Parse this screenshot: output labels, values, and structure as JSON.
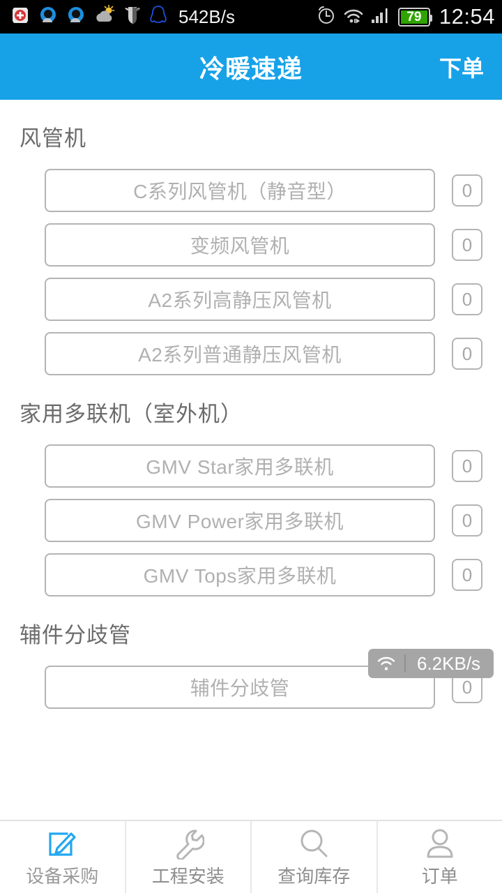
{
  "statusbar": {
    "network_speed": "542B/s",
    "clock": "12:54",
    "battery_level": "79",
    "left_icons": [
      "red-cross-medical-icon",
      "qq-browser-icon",
      "qq-browser-icon-2",
      "weather-sun-cloud-icon",
      "shield-security-icon",
      "qq-penguin-icon"
    ],
    "right_icons": [
      "alarm-clock-icon",
      "wifi-icon",
      "signal-bars-icon",
      "battery-icon"
    ]
  },
  "header": {
    "title": "冷暖速递",
    "action_label": "下单"
  },
  "sections": [
    {
      "title": "风管机",
      "items": [
        {
          "label": "C系列风管机（静音型）",
          "count": "0"
        },
        {
          "label": "变频风管机",
          "count": "0"
        },
        {
          "label": "A2系列高静压风管机",
          "count": "0"
        },
        {
          "label": "A2系列普通静压风管机",
          "count": "0"
        }
      ]
    },
    {
      "title": "家用多联机（室外机）",
      "items": [
        {
          "label": "GMV Star家用多联机",
          "count": "0"
        },
        {
          "label": "GMV Power家用多联机",
          "count": "0"
        },
        {
          "label": "GMV Tops家用多联机",
          "count": "0"
        }
      ]
    },
    {
      "title": "辅件分歧管",
      "items": [
        {
          "label": "辅件分歧管",
          "count": "0"
        }
      ]
    }
  ],
  "network_toast": {
    "icon": "wifi-icon",
    "speed": "6.2KB/s"
  },
  "tabbar": {
    "tabs": [
      {
        "label": "设备采购",
        "icon": "edit-document-icon",
        "active": true
      },
      {
        "label": "工程安装",
        "icon": "wrench-icon",
        "active": false
      },
      {
        "label": "查询库存",
        "icon": "search-icon",
        "active": false
      },
      {
        "label": "订单",
        "icon": "person-icon",
        "active": false
      }
    ]
  },
  "colors": {
    "accent": "#17a2e8",
    "border": "#b4b4b4",
    "placeholder_text": "#b0b0b0",
    "section_title": "#6b6b6b",
    "battery_green": "#2fa400",
    "toast_bg": "#a6a6a6"
  }
}
